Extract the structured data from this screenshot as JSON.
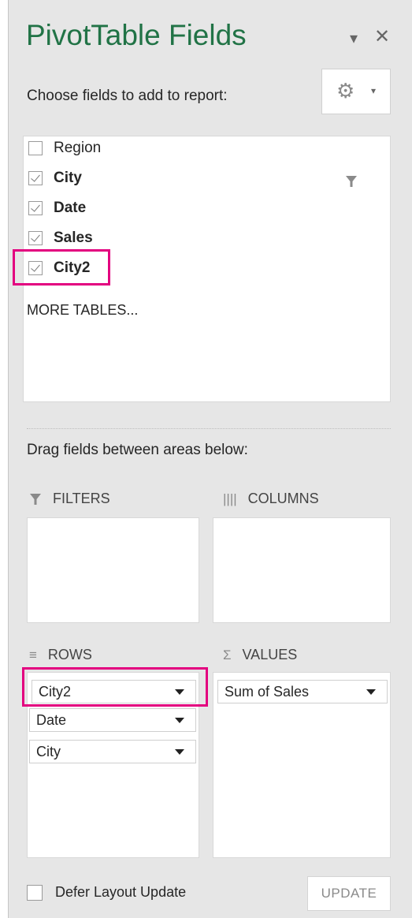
{
  "panel": {
    "title": "PivotTable Fields",
    "close_glyph": "✕",
    "options_glyph": "▾",
    "choose_label": "Choose fields to add to report:",
    "tools_icon": "gear-icon",
    "tools_caret": "▾"
  },
  "fields": [
    {
      "label": "Region",
      "checked": false,
      "bold": false
    },
    {
      "label": "City",
      "checked": true,
      "bold": true,
      "filtered": true
    },
    {
      "label": "Date",
      "checked": true,
      "bold": true
    },
    {
      "label": "Sales",
      "checked": true,
      "bold": true
    },
    {
      "label": "City2",
      "checked": true,
      "bold": true,
      "highlighted": true
    }
  ],
  "more_tables": "MORE TABLES...",
  "drag_label": "Drag fields between areas below:",
  "areas": {
    "filters": {
      "title": "FILTERS",
      "items": []
    },
    "columns": {
      "title": "COLUMNS",
      "items": []
    },
    "rows": {
      "title": "ROWS",
      "items": [
        "City2",
        "Date",
        "City"
      ]
    },
    "values": {
      "title": "VALUES",
      "items": [
        "Sum of Sales"
      ]
    }
  },
  "footer": {
    "defer_label": "Defer Layout Update",
    "defer_checked": false,
    "update_label": "UPDATE"
  },
  "colors": {
    "title": "#217346",
    "highlight": "#e3007f",
    "pane": "#e6e6e6"
  }
}
